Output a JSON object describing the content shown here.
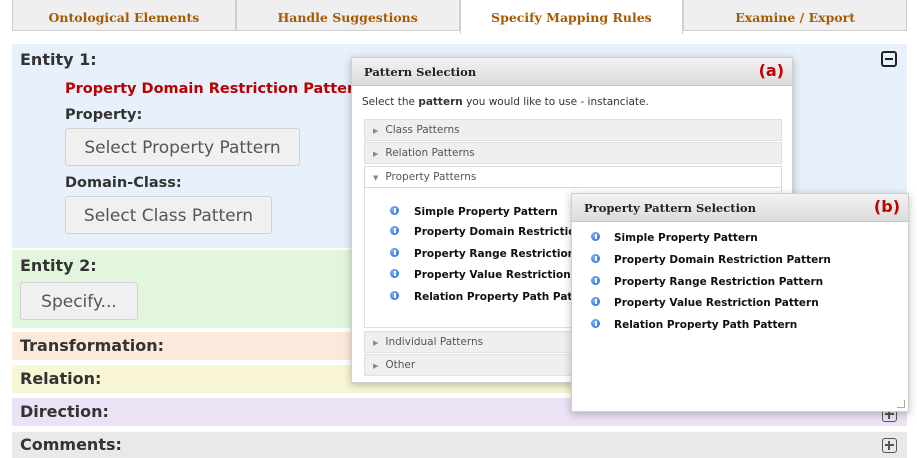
{
  "tabs": [
    "Ontological Elements",
    "Handle Suggestions",
    "Specify Mapping Rules",
    "Examine / Export"
  ],
  "entity1": {
    "title": "Entity 1:",
    "pattern_title": "Property Domain Restriction Pattern",
    "property_label": "Property:",
    "property_button": "Select Property Pattern",
    "domain_label": "Domain-Class:",
    "class_button": "Select Class Pattern"
  },
  "entity2": {
    "title": "Entity 2:",
    "specify_button": "Specify..."
  },
  "sections": {
    "transformation": "Transformation:",
    "relation": "Relation:",
    "direction": "Direction:",
    "comments": "Comments:"
  },
  "pattern_dialog": {
    "title": "Pattern Selection",
    "tag": "(a)",
    "instruction_pre": "Select the ",
    "instruction_bold": "pattern",
    "instruction_post": " you would like to use - instanciate.",
    "sections": [
      "Class Patterns",
      "Relation Patterns",
      "Property Patterns",
      "Individual Patterns",
      "Other"
    ],
    "items": [
      "Simple Property Pattern",
      "Property Domain Restriction",
      "Property Range Restriction P",
      "Property Value Restriction Pa",
      "Relation Property Path Patter"
    ]
  },
  "property_dialog": {
    "title": "Property Pattern Selection",
    "tag": "(b)",
    "items": [
      "Simple Property Pattern",
      "Property Domain Restriction Pattern",
      "Property Range Restriction Pattern",
      "Property Value Restriction Pattern",
      "Relation Property Path Pattern"
    ]
  },
  "colors": {
    "entity1_bg": "#e7f0fb",
    "entity2_bg": "#e2f6dd",
    "transformation_bg": "#fbe9dc",
    "relation_bg": "#f8f6d4",
    "direction_bg": "#ece2f6",
    "comments_bg": "#e9e9e9",
    "accent_red": "#c00000",
    "tab_text": "#a85a00"
  }
}
